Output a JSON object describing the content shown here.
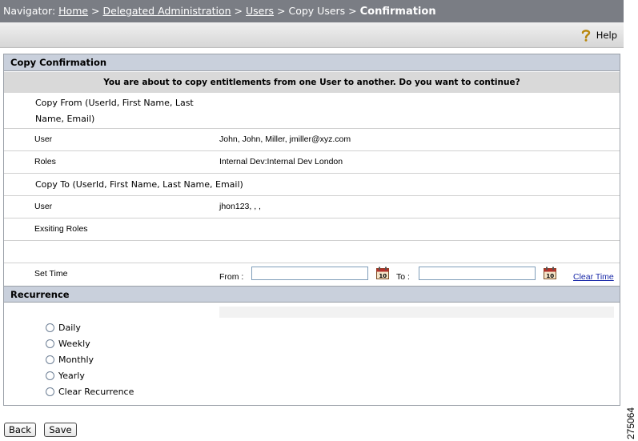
{
  "navigator": {
    "label": "Navigator:",
    "sep": ">",
    "crumbs": [
      "Home",
      "Delegated Administration",
      "Users",
      "Copy Users"
    ],
    "current": "Confirmation"
  },
  "toolbar": {
    "help_label": "Help",
    "help_icon": "question-mark-icon"
  },
  "copy_section": {
    "title": "Copy Confirmation",
    "notice": "You are about to copy entitlements from one User to another. Do you want to continue?",
    "from_header": "Copy From (UserId, First Name, Last Name, Email)",
    "from_header_line1": "Copy From (UserId, First Name, Last",
    "from_header_line2": "Name, Email)",
    "from_user_label": "User",
    "from_user_value": "John, John, Miller, jmiller@xyz.com",
    "roles_label": "Roles",
    "roles_value": "Internal Dev:Internal Dev London",
    "to_header": "Copy To (UserId, First Name, Last Name, Email)",
    "to_user_label": "User",
    "to_user_value": "jhon123, , ,",
    "existing_roles_label": "Exsiting Roles",
    "set_time_label": "Set Time",
    "from_label": "From :",
    "to_label": "To :",
    "from_value": "",
    "to_value": "",
    "calendar_text": "10",
    "clear_time": "Clear Time"
  },
  "recurrence": {
    "title": "Recurrence",
    "options": [
      "Daily",
      "Weekly",
      "Monthly",
      "Yearly",
      "Clear Recurrence"
    ]
  },
  "buttons": {
    "back": "Back",
    "save": "Save"
  },
  "figure_number": "275064",
  "colors": {
    "nav_bg": "#7a7d84",
    "section_header_bg": "#c9d0dc",
    "notice_bg": "#d9d9d9",
    "link": "#1a2aa8"
  }
}
